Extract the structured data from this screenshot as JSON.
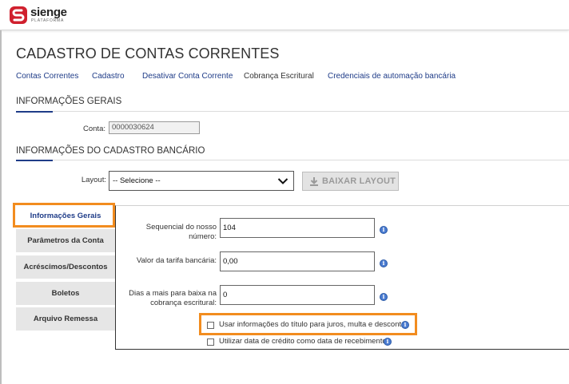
{
  "header": {
    "logo_text": "sienge",
    "logo_subtext": "PLATAFORMA"
  },
  "page_title": "CADASTRO DE CONTAS CORRENTES",
  "nav": {
    "items": [
      {
        "label": "Contas Correntes"
      },
      {
        "label": "Cadastro"
      },
      {
        "label": "Desativar Conta Corrente"
      },
      {
        "label": "Cobrança Escritural",
        "active": true
      },
      {
        "label": "Credenciais de automação bancária"
      }
    ]
  },
  "section_general": {
    "title": "INFORMAÇÕES GERAIS",
    "conta_label": "Conta:",
    "conta_value": "0000030624"
  },
  "section_bank": {
    "title": "INFORMAÇÕES DO CADASTRO BANCÁRIO",
    "layout_label": "Layout:",
    "layout_selected": "-- Selecione --",
    "download_button": "BAIXAR LAYOUT"
  },
  "tabs": [
    {
      "label": "Informações Gerais",
      "active": true
    },
    {
      "label": "Parâmetros da Conta"
    },
    {
      "label": "Acréscimos/Descontos"
    },
    {
      "label": "Boletos"
    },
    {
      "label": "Arquivo Remessa"
    }
  ],
  "fields": {
    "sequencial": {
      "label_line1": "Sequencial do nosso",
      "label_line2": "número:",
      "value": "104"
    },
    "tarifa": {
      "label": "Valor da tarifa bancária:",
      "value": "0,00"
    },
    "dias": {
      "label_line1": "Dias a mais para baixa na",
      "label_line2": "cobrança escritural:",
      "value": "0"
    }
  },
  "checkboxes": {
    "usar_info": {
      "label": "Usar informações do título para juros, multa e desconto",
      "checked": false
    },
    "data_credito": {
      "label": "Utilizar data de crédito como data de recebimento",
      "checked": false
    }
  },
  "colors": {
    "accent_blue": "#1f3c88",
    "highlight_orange": "#f28c1f",
    "brand_red": "#d0202e"
  },
  "icons": {
    "info": "info-icon",
    "download": "download-icon",
    "chevron": "chevron-down-icon"
  }
}
